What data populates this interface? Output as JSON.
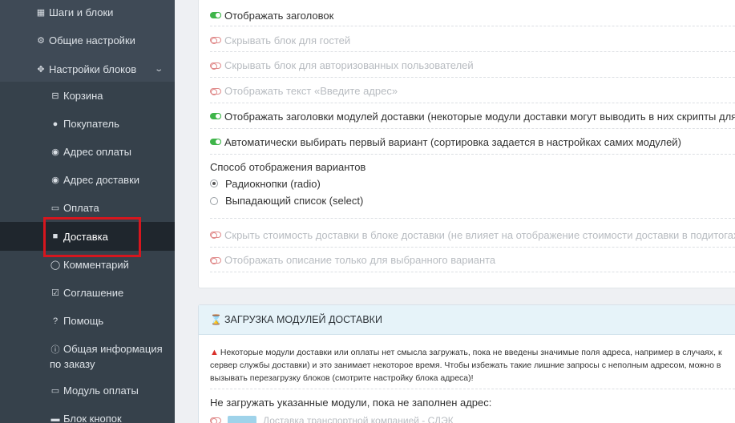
{
  "sidebar": {
    "items": [
      {
        "label": "Шаги и блоки",
        "icon": "grid-icon",
        "level": "top"
      },
      {
        "label": "Общие настройки",
        "icon": "gear-icon",
        "level": "top"
      },
      {
        "label": "Настройки блоков",
        "icon": "puzzle-icon",
        "level": "top",
        "expanded": true
      },
      {
        "label": "Корзина",
        "icon": "basket-icon",
        "level": "sub"
      },
      {
        "label": "Покупатель",
        "icon": "user-icon",
        "level": "sub"
      },
      {
        "label": "Адрес оплаты",
        "icon": "globe-icon",
        "level": "sub"
      },
      {
        "label": "Адрес доставки",
        "icon": "globe-icon",
        "level": "sub"
      },
      {
        "label": "Оплата",
        "icon": "credit-card-icon",
        "level": "sub"
      },
      {
        "label": "Доставка",
        "icon": "truck-icon",
        "level": "sub",
        "active": true
      },
      {
        "label": "Комментарий",
        "icon": "comment-icon",
        "level": "sub"
      },
      {
        "label": "Соглашение",
        "icon": "checkbox-icon",
        "level": "sub"
      },
      {
        "label": "Помощь",
        "icon": "question-icon",
        "level": "sub"
      },
      {
        "label": "Общая информация",
        "label2": "по заказу",
        "icon": "info-icon",
        "level": "sub"
      },
      {
        "label": "Модуль оплаты",
        "icon": "credit-card-icon",
        "level": "sub"
      },
      {
        "label": "Блок кнопок",
        "icon": "minus-icon",
        "level": "sub"
      }
    ]
  },
  "settings": {
    "toggles": [
      {
        "label": "Отображать заголовок",
        "on": true
      },
      {
        "label": "Скрывать блок для гостей",
        "on": false
      },
      {
        "label": "Скрывать блок для авторизованных пользователей",
        "on": false
      },
      {
        "label": "Отображать текст «Введите адрес»",
        "on": false
      },
      {
        "label": "Отображать заголовки модулей доставки (некоторые модули доставки могут выводить в них скрипты для кар",
        "on": true
      },
      {
        "label": "Автоматически выбирать первый вариант (сортировка задается в настройках самих модулей)",
        "on": true
      }
    ],
    "display_mode": {
      "title": "Способ отображения вариантов",
      "options": [
        {
          "label": "Радиокнопки (radio)",
          "checked": true
        },
        {
          "label": "Выпадающий список (select)",
          "checked": false
        }
      ]
    },
    "toggles2": [
      {
        "label": "Скрыть стоимость доставки в блоке доставки (не влияет на отображение стоимости доставки в подитогах ко",
        "on": false
      },
      {
        "label": "Отображать описание только для выбранного варианта",
        "on": false
      }
    ]
  },
  "loading_section": {
    "title": "ЗАГРУЗКА МОДУЛЕЙ ДОСТАВКИ",
    "warning_lines": [
      "Некоторые модули доставки или оплаты нет смысла загружать, пока не введены значимые поля адреса, например в случаях, к",
      "сервер службы доставки) и это занимает некоторое время. Чтобы избежать такие лишние запросы с неполным адресом, можно в",
      "вызывать перезагрузку блоков (смотрите настройку блока адреса)!"
    ],
    "not_load_label": "Не загружать указанные модули, пока не заполнен адрес:",
    "partial_item": "Доставка транспортной компанией - СДЭК"
  },
  "colors": {
    "sidebar_bg": "#3f4a56",
    "active_bg": "#1f262d",
    "toggle_on": "#3fb54a",
    "toggle_off": "#e08a8a",
    "highlight": "#d6161e"
  }
}
